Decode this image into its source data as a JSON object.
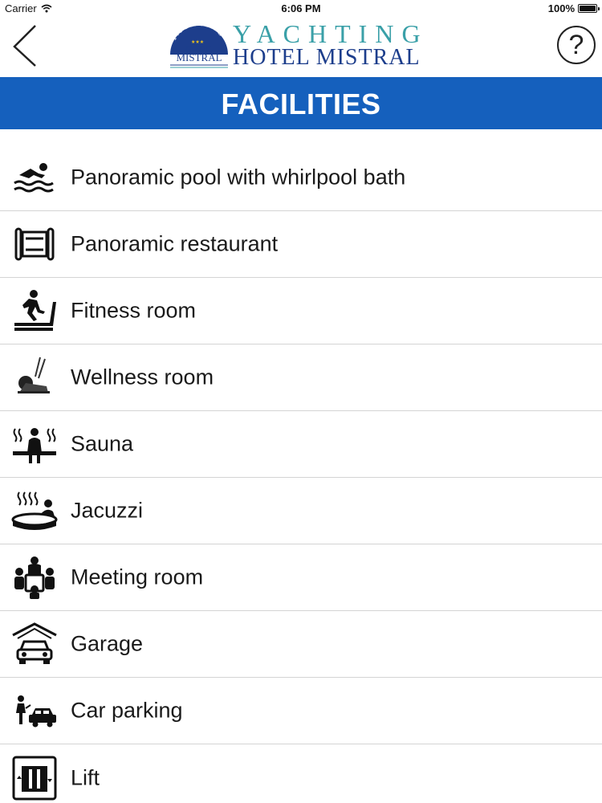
{
  "status_bar": {
    "carrier": "Carrier",
    "time": "6:06 PM",
    "battery": "100%"
  },
  "logo": {
    "arc_text": "YACHTING",
    "badge_line1": "HOTEL",
    "badge_line2": "MISTRAL",
    "word_top": "YACHTING",
    "word_bottom": "HOTEL MISTRAL"
  },
  "nav": {
    "back_icon": "chevron-left-icon",
    "help_icon": "help-icon",
    "help_glyph": "?"
  },
  "page": {
    "title": "FACILITIES"
  },
  "facilities": [
    {
      "label": "Panoramic pool with whirlpool bath",
      "icon": "swimmer-icon"
    },
    {
      "label": "Panoramic restaurant",
      "icon": "restaurant-icon"
    },
    {
      "label": "Fitness room",
      "icon": "treadmill-icon"
    },
    {
      "label": "Wellness room",
      "icon": "elliptical-icon"
    },
    {
      "label": "Sauna",
      "icon": "sauna-icon"
    },
    {
      "label": "Jacuzzi",
      "icon": "jacuzzi-icon"
    },
    {
      "label": "Meeting room",
      "icon": "meeting-icon"
    },
    {
      "label": "Garage",
      "icon": "garage-icon"
    },
    {
      "label": "Car parking",
      "icon": "car-parking-icon"
    },
    {
      "label": "Lift",
      "icon": "lift-icon"
    }
  ],
  "colors": {
    "banner": "#1560bd",
    "logo_teal": "#3aa0a8",
    "logo_navy": "#1d3e8c"
  }
}
